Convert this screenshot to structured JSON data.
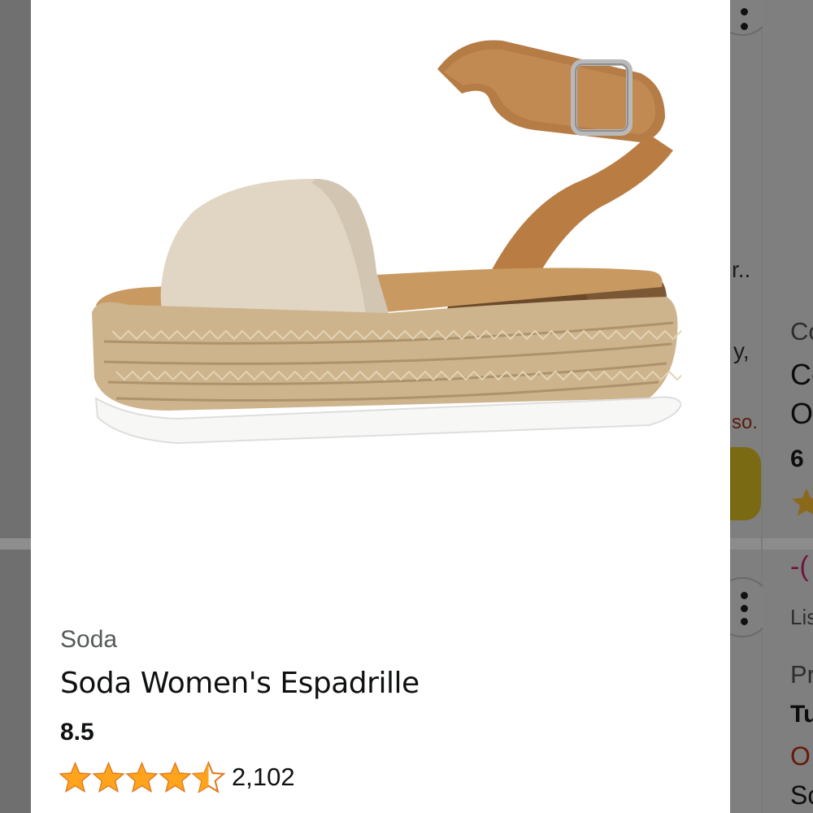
{
  "product": {
    "brand": "Soda",
    "title": "Soda Women's Espadrille",
    "size": "8.5",
    "rating": 4.5,
    "review_count": "2,102"
  },
  "adjacent_card_mid": {
    "text_1": "r..",
    "text_2": "y,",
    "text_3": "so."
  },
  "adjacent_card_right": {
    "line_1": "Co",
    "line_2": "Ce",
    "line_3": "O",
    "line_4": "6",
    "line_5": "-(",
    "line_6": "Lis",
    "line_7": "Pr",
    "line_8": "Tu",
    "line_9": "O",
    "line_10": "Sc"
  },
  "colors": {
    "star": "#ffa41c",
    "star_outline": "#de7921",
    "text_primary": "#0f1111",
    "text_secondary": "#565959"
  }
}
